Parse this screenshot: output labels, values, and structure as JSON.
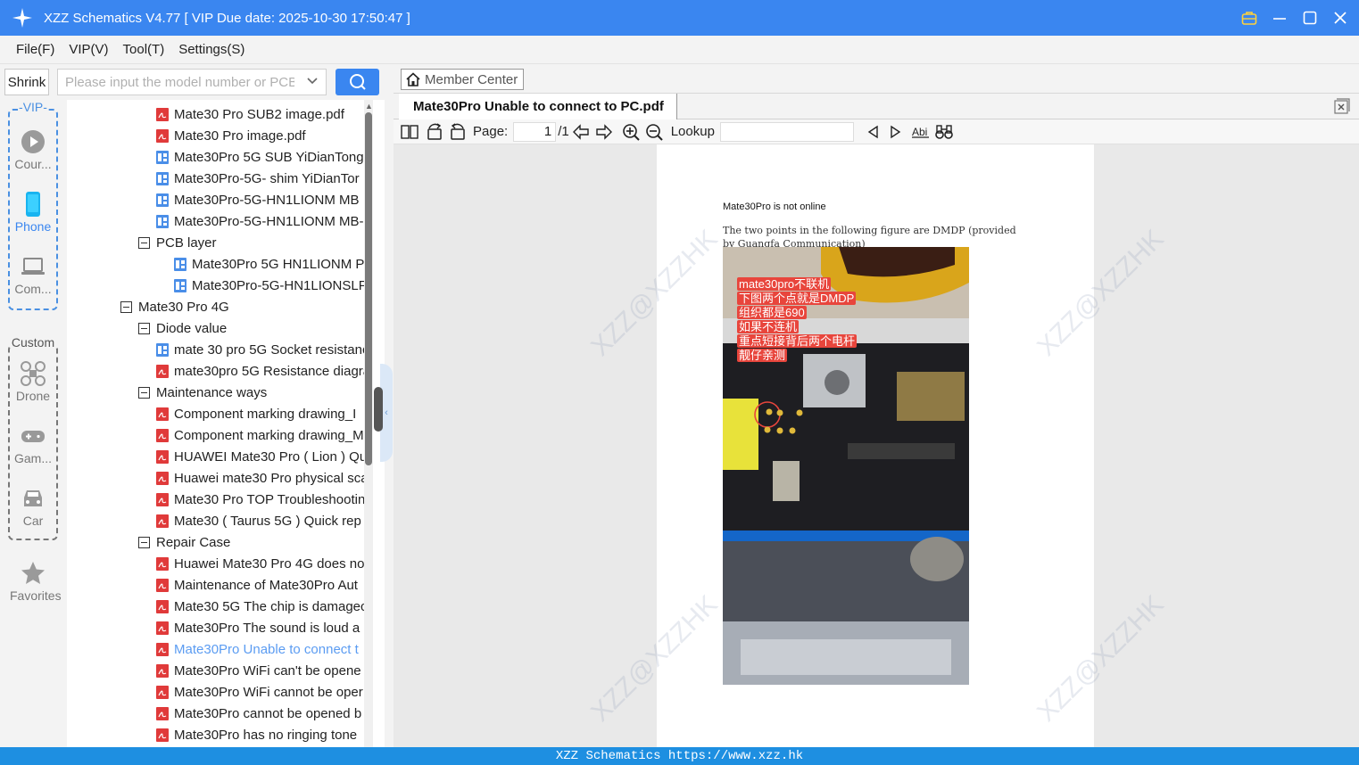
{
  "window": {
    "title": "XZZ Schematics V4.77 [ VIP Due date: 2025-10-30 17:50:47 ]"
  },
  "menu": {
    "items": [
      "File(F)",
      "VIP(V)",
      "Tool(T)",
      "Settings(S)"
    ]
  },
  "search": {
    "shrink_label": "Shrink",
    "placeholder": "Please input the model number or PCB"
  },
  "rail": {
    "vip_label": "-VIP-",
    "custom_label": "Custom",
    "items": [
      {
        "label": "Cour...",
        "icon": "play-icon"
      },
      {
        "label": "Phone",
        "icon": "phone-icon"
      },
      {
        "label": "Com...",
        "icon": "laptop-icon"
      },
      {
        "label": "Drone",
        "icon": "drone-icon"
      },
      {
        "label": "Gam...",
        "icon": "gamepad-icon"
      },
      {
        "label": "Car",
        "icon": "car-icon"
      },
      {
        "label": "Favorites",
        "icon": "star-icon"
      }
    ]
  },
  "tree": {
    "rows": [
      {
        "label": "Mate30 Pro SUB2 image.pdf",
        "type": "pdf"
      },
      {
        "label": "Mate30 Pro image.pdf",
        "type": "pdf"
      },
      {
        "label": "Mate30Pro 5G SUB YiDianTong",
        "type": "pcb"
      },
      {
        "label": "Mate30Pro-5G- shim YiDianTor",
        "type": "pcb"
      },
      {
        "label": "Mate30Pro-5G-HN1LIONM MB",
        "type": "pcb"
      },
      {
        "label": "Mate30Pro-5G-HN1LIONM MB-",
        "type": "pcb"
      },
      {
        "label": "PCB layer",
        "type": "folder"
      },
      {
        "label": "Mate30Pro 5G HN1LIONM P",
        "type": "pcb"
      },
      {
        "label": "Mate30Pro-5G-HN1LIONSLF",
        "type": "pcb"
      },
      {
        "label": "Mate30 Pro 4G",
        "type": "folder"
      },
      {
        "label": "Diode value",
        "type": "folder"
      },
      {
        "label": "mate 30 pro 5G Socket resistanc",
        "type": "pcb"
      },
      {
        "label": "mate30pro 5G Resistance diagra",
        "type": "pdf"
      },
      {
        "label": "Maintenance ways",
        "type": "folder"
      },
      {
        "label": "Component marking drawing_I",
        "type": "pdf"
      },
      {
        "label": "Component marking drawing_M",
        "type": "pdf"
      },
      {
        "label": "HUAWEI Mate30 Pro ( Lion ) Qu",
        "type": "pdf"
      },
      {
        "label": "Huawei mate30 Pro physical sca",
        "type": "pdf"
      },
      {
        "label": "Mate30 Pro TOP Troubleshootin",
        "type": "pdf"
      },
      {
        "label": "Mate30 ( Taurus 5G ) Quick rep",
        "type": "pdf"
      },
      {
        "label": "Repair Case",
        "type": "folder"
      },
      {
        "label": "Huawei Mate30 Pro 4G does no",
        "type": "pdf"
      },
      {
        "label": "Maintenance of Mate30Pro Aut",
        "type": "pdf"
      },
      {
        "label": "Mate30 5G The chip is damagec",
        "type": "pdf"
      },
      {
        "label": "Mate30Pro The sound is loud a",
        "type": "pdf"
      },
      {
        "label": "Mate30Pro Unable to connect t",
        "type": "pdf",
        "selected": true
      },
      {
        "label": "Mate30Pro WiFi can't be opene",
        "type": "pdf"
      },
      {
        "label": "Mate30Pro WiFi cannot be oper",
        "type": "pdf"
      },
      {
        "label": "Mate30Pro cannot be opened b",
        "type": "pdf"
      },
      {
        "label": "Mate30Pro has no ringing tone",
        "type": "pdf"
      }
    ]
  },
  "right": {
    "member_center_label": "Member Center",
    "tab_label": "Mate30Pro Unable to connect to PC.pdf",
    "toolbar": {
      "page_label": "Page:",
      "page_current": "1",
      "page_total": "/1",
      "lookup_label": "Lookup"
    }
  },
  "pdf": {
    "heading": "Mate30Pro is not online",
    "body": "The two points in the following figure are DMDP (provided by Guangfa Communication)",
    "photo_note": [
      "mate30pro不联机",
      "下图两个点就是DMDP",
      "组织都是690",
      "如果不连机",
      "重点短接背后两个电杆",
      "靓仔亲测"
    ],
    "watermark": "XZZ@XZZHK"
  },
  "status": {
    "text": "XZZ Schematics https://www.xzz.hk"
  },
  "colors": {
    "accent": "#3a86f0",
    "status_bar": "#1e8fe1",
    "pdf_icon": "#e03a3a",
    "pcb_icon": "#4a8ee8"
  }
}
